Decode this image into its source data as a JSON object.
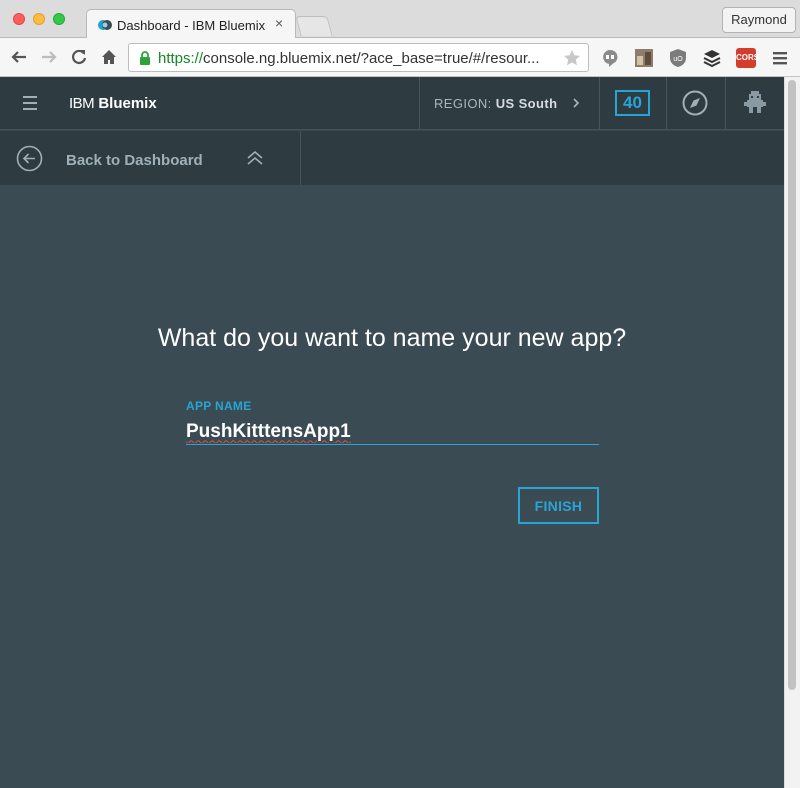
{
  "browser": {
    "tab_title": "Dashboard - IBM Bluemix",
    "tab_close": "×",
    "profile_name": "Raymond",
    "url_scheme": "https://",
    "url_rest": "console.ng.bluemix.net/?ace_base=true/#/resour...",
    "cors_label": "CORS"
  },
  "appbar": {
    "brand_prefix": "IBM",
    "brand_name": "Bluemix",
    "region_label": "REGION:",
    "region_value": "US South",
    "notification_count": "40"
  },
  "subbar": {
    "back_label": "Back to Dashboard"
  },
  "main": {
    "question": "What do you want to name your new app?",
    "field_label": "APP NAME",
    "app_name_value": "PushKitttensApp1",
    "finish_label": "FINISH"
  },
  "colors": {
    "accent": "#27a5d6",
    "header_bg": "#2e3b41",
    "page_bg": "#3b4b53"
  }
}
